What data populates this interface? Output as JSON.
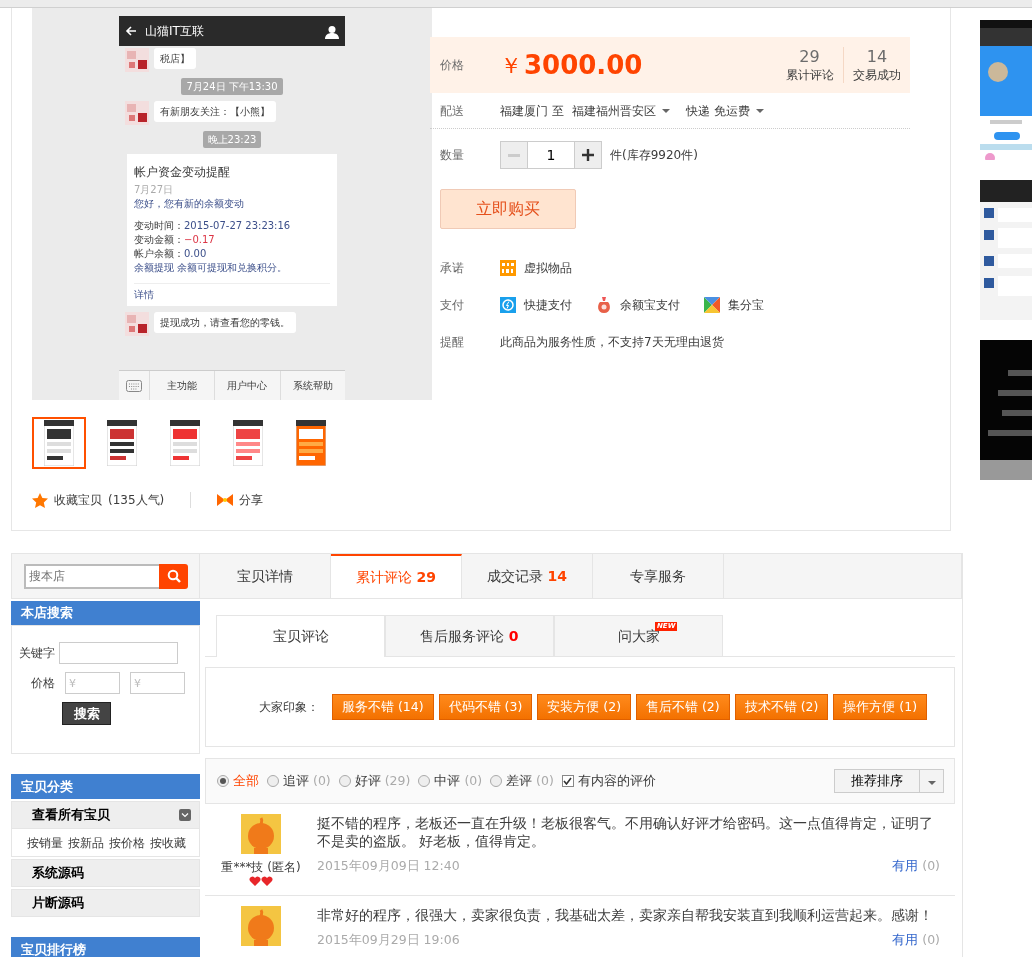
{
  "gallery": {
    "phone_screen": {
      "title": "山猫IT互联",
      "messages": [
        {
          "kind": "bubble",
          "text": "税店】"
        },
        {
          "kind": "time",
          "text": "7月24日 下午13:30"
        },
        {
          "kind": "bubble",
          "text": "有新朋友关注：【小熊】"
        },
        {
          "kind": "time",
          "text": "晚上23:23"
        },
        {
          "kind": "card",
          "title": "帐户资金变动提醒",
          "date": "7月27日",
          "greeting": "您好，您有新的余额变动",
          "lines": [
            {
              "label": "变动时间：",
              "value": "2015-07-27 23:23:16",
              "negative": false
            },
            {
              "label": "变动金额：",
              "value": "−0.17",
              "negative": true
            },
            {
              "label": "帐户余额：",
              "value": "0.00",
              "negative": false
            }
          ],
          "note": "余额提现 余额可提现和兑换积分。",
          "link": "详情"
        },
        {
          "kind": "bubble",
          "text": "提现成功，请查看您的零钱。"
        }
      ],
      "menu": [
        "主功能",
        "用户中心",
        "系统帮助"
      ]
    },
    "thumbnails": [
      {
        "selected": true
      },
      {
        "selected": false
      },
      {
        "selected": false
      },
      {
        "selected": false
      },
      {
        "selected": false
      }
    ]
  },
  "collect": {
    "label": "收藏宝贝",
    "count": "(135人气)"
  },
  "share": "分享",
  "price": {
    "label": "价格",
    "currency": "￥",
    "amount": "3000.00",
    "stats": [
      {
        "value": "29",
        "label": "累计评论"
      },
      {
        "value": "14",
        "label": "交易成功"
      }
    ]
  },
  "delivery": {
    "label": "配送",
    "from": "福建厦门 至",
    "to": "福建福州晋安区",
    "method": "快递 免运费"
  },
  "quantity": {
    "label": "数量",
    "value": "1",
    "stock": "件(库存9920件)"
  },
  "buy_button": "立即购买",
  "promise": {
    "label": "承诺",
    "items": [
      {
        "kind": "virtual",
        "label": "虚拟物品"
      }
    ]
  },
  "payment": {
    "label": "支付",
    "items": [
      {
        "kind": "quick",
        "label": "快捷支付"
      },
      {
        "kind": "yuebao",
        "label": "余额宝支付"
      },
      {
        "kind": "jifen",
        "label": "集分宝"
      }
    ]
  },
  "notice": {
    "label": "提醒",
    "text": "此商品为服务性质，不支持7天无理由退货"
  },
  "shop_search": {
    "placeholder": "搜本店"
  },
  "store_search": {
    "title": "本店搜索",
    "keyword_label": "关键字",
    "price_label": "价格",
    "price_min_placeholder": "¥",
    "price_max_placeholder": "¥",
    "button": "搜索"
  },
  "categories": {
    "title": "宝贝分类",
    "items": [
      {
        "kind": "all",
        "label": "查看所有宝贝",
        "expanded": true,
        "sort_links": [
          "按销量",
          "按新品",
          "按价格",
          "按收藏"
        ]
      },
      {
        "kind": "category",
        "label": "系统源码"
      },
      {
        "kind": "category",
        "label": "片断源码"
      }
    ]
  },
  "ranking": {
    "title": "宝贝排行榜"
  },
  "tabs": [
    {
      "label": "宝贝详情",
      "selected": false
    },
    {
      "label": "累计评论",
      "count": "29",
      "selected": true
    },
    {
      "label": "成交记录",
      "count": "14",
      "selected": false
    },
    {
      "label": "专享服务",
      "selected": false
    }
  ],
  "review_tabs": [
    {
      "label": "宝贝评论",
      "selected": true
    },
    {
      "label": "售后服务评论",
      "count": "0",
      "selected": false
    },
    {
      "label": "问大家",
      "badge": "NEW",
      "selected": false
    }
  ],
  "impressions": {
    "label": "大家印象：",
    "tags": [
      "服务不错 (14)",
      "代码不错 (3)",
      "安装方便 (2)",
      "售后不错 (2)",
      "技术不错 (2)",
      "操作方便 (1)"
    ]
  },
  "filters": [
    {
      "label": "全部",
      "selected": true
    },
    {
      "label": "追评",
      "count": "(0)",
      "selected": false
    },
    {
      "label": "好评",
      "count": "(29)",
      "selected": false
    },
    {
      "label": "中评",
      "count": "(0)",
      "selected": false
    },
    {
      "label": "差评",
      "count": "(0)",
      "selected": false
    }
  ],
  "content_only": {
    "label": "有内容的评价",
    "checked": true
  },
  "sort": {
    "label": "推荐排序"
  },
  "reviews": [
    {
      "text": "挺不错的程序，老板还一直在升级！老板很客气。不用确认好评才给密码。这一点值得肯定，证明了不是卖的盗版。 好老板，值得肯定。",
      "user": "重***技 (匿名)",
      "rank_badge": true,
      "date": "2015年09月09日 12:40",
      "useful_label": "有用",
      "useful_count": "(0)"
    },
    {
      "text": "非常好的程序，很强大，卖家很负责，我基础太差，卖家亲自帮我安装直到我顺利运营起来。感谢！",
      "rank_badge": false,
      "date": "2015年09月29日 19:06",
      "useful_label": "有用",
      "useful_count": "(0)"
    }
  ]
}
